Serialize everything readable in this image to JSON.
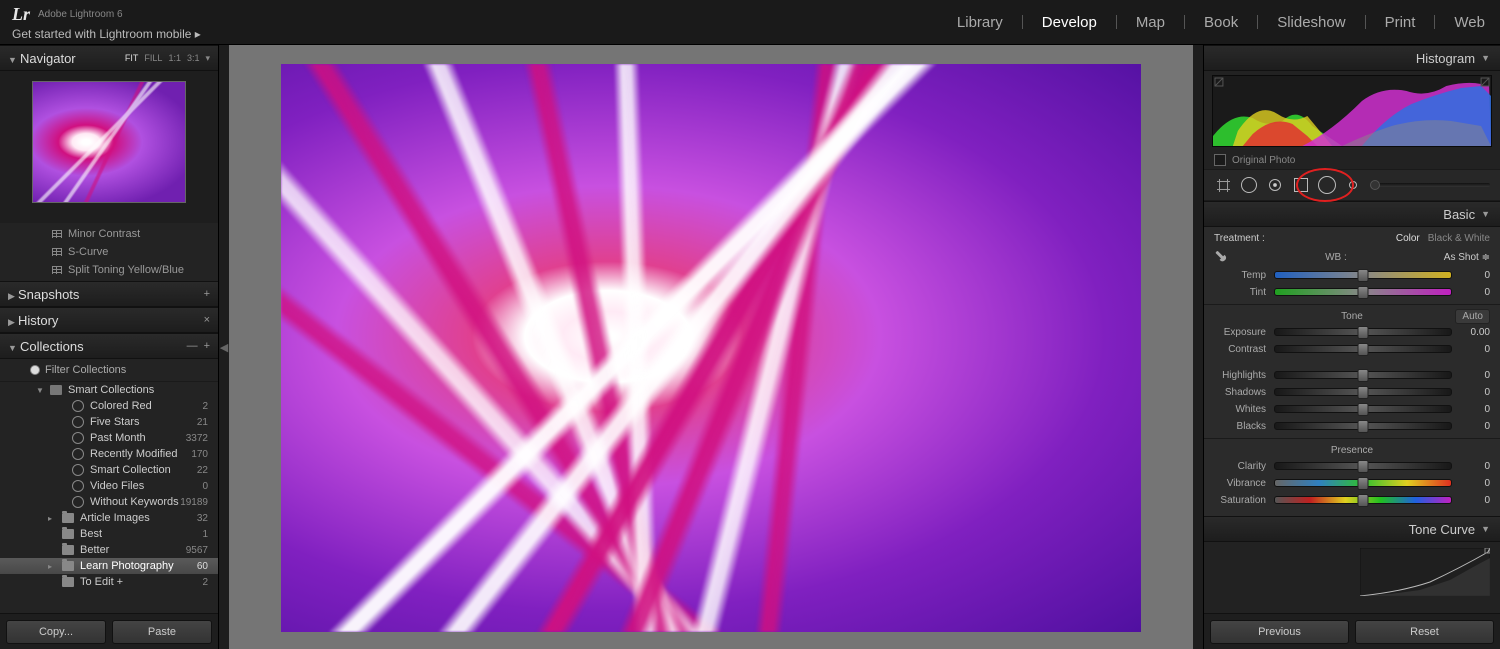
{
  "app": {
    "name": "Adobe Lightroom 6",
    "mobile_link": "Get started with Lightroom mobile  ▸",
    "logo": "Lr"
  },
  "modules": [
    "Library",
    "Develop",
    "Map",
    "Book",
    "Slideshow",
    "Print",
    "Web"
  ],
  "active_module": "Develop",
  "navigator": {
    "title": "Navigator",
    "zoom": [
      "FIT",
      "FILL",
      "1:1",
      "3:1"
    ],
    "zoom_sel": "FIT"
  },
  "presets": [
    "Minor Contrast",
    "S-Curve",
    "Split Toning Yellow/Blue"
  ],
  "snapshots": {
    "title": "Snapshots"
  },
  "history": {
    "title": "History"
  },
  "collections": {
    "title": "Collections",
    "filter": "Filter Collections",
    "smart_label": "Smart Collections",
    "smart": [
      {
        "name": "Colored Red",
        "count": 2
      },
      {
        "name": "Five Stars",
        "count": 21
      },
      {
        "name": "Past Month",
        "count": 3372
      },
      {
        "name": "Recently Modified",
        "count": 170
      },
      {
        "name": "Smart Collection",
        "count": 22
      },
      {
        "name": "Video Files",
        "count": 0
      },
      {
        "name": "Without Keywords",
        "count": 19189
      }
    ],
    "regular": [
      {
        "name": "Article Images",
        "count": 32
      },
      {
        "name": "Best",
        "count": 1
      },
      {
        "name": "Better",
        "count": 9567
      },
      {
        "name": "Learn Photography",
        "count": 60,
        "selected": true
      },
      {
        "name": "To Edit  +",
        "count": 2
      }
    ]
  },
  "buttons": {
    "copy": "Copy...",
    "paste": "Paste",
    "previous": "Previous",
    "reset": "Reset"
  },
  "histogram": {
    "title": "Histogram",
    "original": "Original Photo"
  },
  "basic": {
    "title": "Basic",
    "treatment_label": "Treatment :",
    "treatments": [
      "Color",
      "Black & White"
    ],
    "treatment_sel": "Color",
    "wb_label": "WB :",
    "wb_value": "As Shot",
    "temp": {
      "label": "Temp",
      "value": 0
    },
    "tint": {
      "label": "Tint",
      "value": 0
    },
    "tone_label": "Tone",
    "auto": "Auto",
    "exposure": {
      "label": "Exposure",
      "value": "0.00"
    },
    "contrast": {
      "label": "Contrast",
      "value": 0
    },
    "highlights": {
      "label": "Highlights",
      "value": 0
    },
    "shadows": {
      "label": "Shadows",
      "value": 0
    },
    "whites": {
      "label": "Whites",
      "value": 0
    },
    "blacks": {
      "label": "Blacks",
      "value": 0
    },
    "presence_label": "Presence",
    "clarity": {
      "label": "Clarity",
      "value": 0
    },
    "vibrance": {
      "label": "Vibrance",
      "value": 0
    },
    "saturation": {
      "label": "Saturation",
      "value": 0
    }
  },
  "tone_curve": {
    "title": "Tone Curve"
  }
}
